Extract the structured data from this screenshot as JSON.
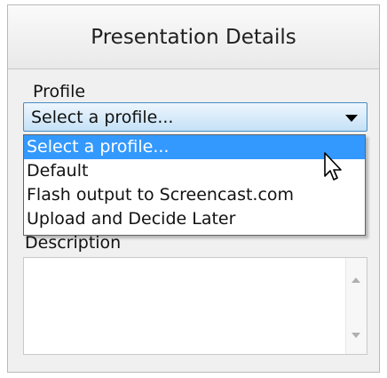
{
  "panel": {
    "title": "Presentation Details"
  },
  "profile": {
    "label": "Profile",
    "selected_value": "Select a profile...",
    "options": [
      "Select a profile...",
      "Default",
      "Flash output to Screencast.com",
      "Upload and Decide Later"
    ],
    "highlighted_index": 0
  },
  "description": {
    "label": "Description",
    "value": ""
  },
  "colors": {
    "highlight": "#3399ff",
    "combo_border": "#4a8bc2"
  },
  "icons": {
    "combo_arrow": "chevron-down-icon",
    "scroll_up": "scroll-up-arrow-icon",
    "scroll_down": "scroll-down-arrow-icon",
    "cursor": "mouse-pointer-icon"
  }
}
